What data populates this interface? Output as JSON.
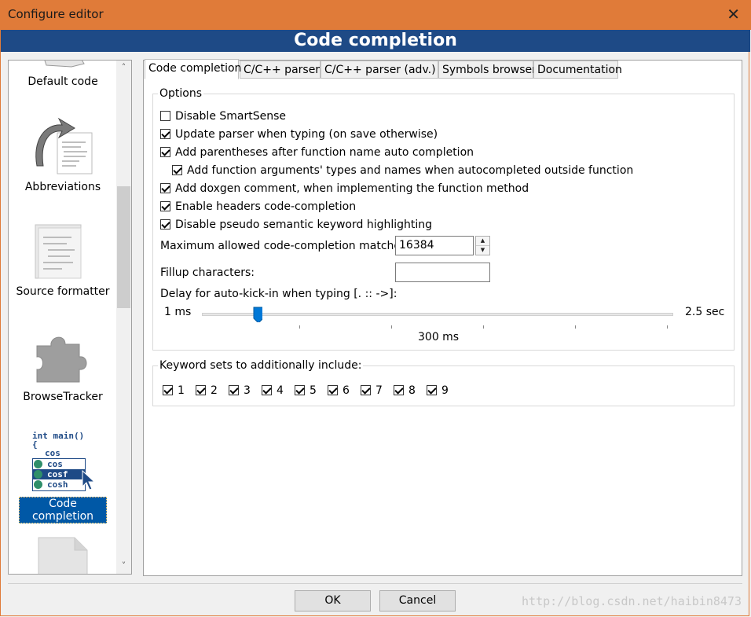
{
  "window": {
    "title": "Configure editor",
    "close_glyph": "✕"
  },
  "header": {
    "title": "Code completion"
  },
  "sidebar": {
    "items": [
      {
        "label": "Default code",
        "icon": "default-code-icon"
      },
      {
        "label": "Abbreviations",
        "icon": "abbreviations-icon"
      },
      {
        "label": "Source formatter",
        "icon": "source-formatter-icon"
      },
      {
        "label": "BrowseTracker",
        "icon": "puzzle-icon"
      },
      {
        "label": "Code completion",
        "icon": "code-completion-icon",
        "selected": true
      }
    ],
    "code_icon_lines": [
      "int main()",
      "{",
      "cos",
      "cos",
      "cosf",
      "cosh"
    ],
    "scroll_up": "˄",
    "scroll_down": "˅"
  },
  "tabs": [
    {
      "label": "Code completion",
      "active": true
    },
    {
      "label": "C/C++ parser"
    },
    {
      "label": "C/C++ parser (adv.)"
    },
    {
      "label": "Symbols browser"
    },
    {
      "label": "Documentation"
    }
  ],
  "options": {
    "title": "Options",
    "checkboxes": [
      {
        "label": "Disable SmartSense",
        "checked": false
      },
      {
        "label": "Update parser when typing (on save otherwise)",
        "checked": true
      },
      {
        "label": "Add parentheses after function name auto completion",
        "checked": true
      },
      {
        "label": "Add function arguments' types and names when autocompleted outside function",
        "checked": true
      },
      {
        "label": "Add doxgen comment, when implementing the function method",
        "checked": true
      },
      {
        "label": "Enable headers code-completion",
        "checked": true
      },
      {
        "label": "Disable pseudo semantic keyword highlighting",
        "checked": true
      }
    ],
    "max_matches_label": "Maximum allowed code-completion matches:",
    "max_matches_value": "16384",
    "fillup_label": "Fillup characters:",
    "fillup_value": "",
    "delay_label": "Delay for auto-kick-in when typing [. :: ->]:",
    "delay_min_label": "1 ms",
    "delay_max_label": "2.5 sec",
    "delay_value_label": "300 ms",
    "delay_fraction": 0.12
  },
  "keywords": {
    "title": "Keyword sets to additionally include:",
    "sets": [
      {
        "label": "1",
        "checked": true
      },
      {
        "label": "2",
        "checked": true
      },
      {
        "label": "3",
        "checked": true
      },
      {
        "label": "4",
        "checked": true
      },
      {
        "label": "5",
        "checked": true
      },
      {
        "label": "6",
        "checked": true
      },
      {
        "label": "7",
        "checked": true
      },
      {
        "label": "8",
        "checked": true
      },
      {
        "label": "9",
        "checked": true
      }
    ]
  },
  "buttons": {
    "ok": "OK",
    "cancel": "Cancel"
  },
  "watermark": "http://blog.csdn.net/haibin8473",
  "colors": {
    "title_bar": "#e07b39",
    "header": "#1e4a86",
    "selection": "#0058a6"
  }
}
